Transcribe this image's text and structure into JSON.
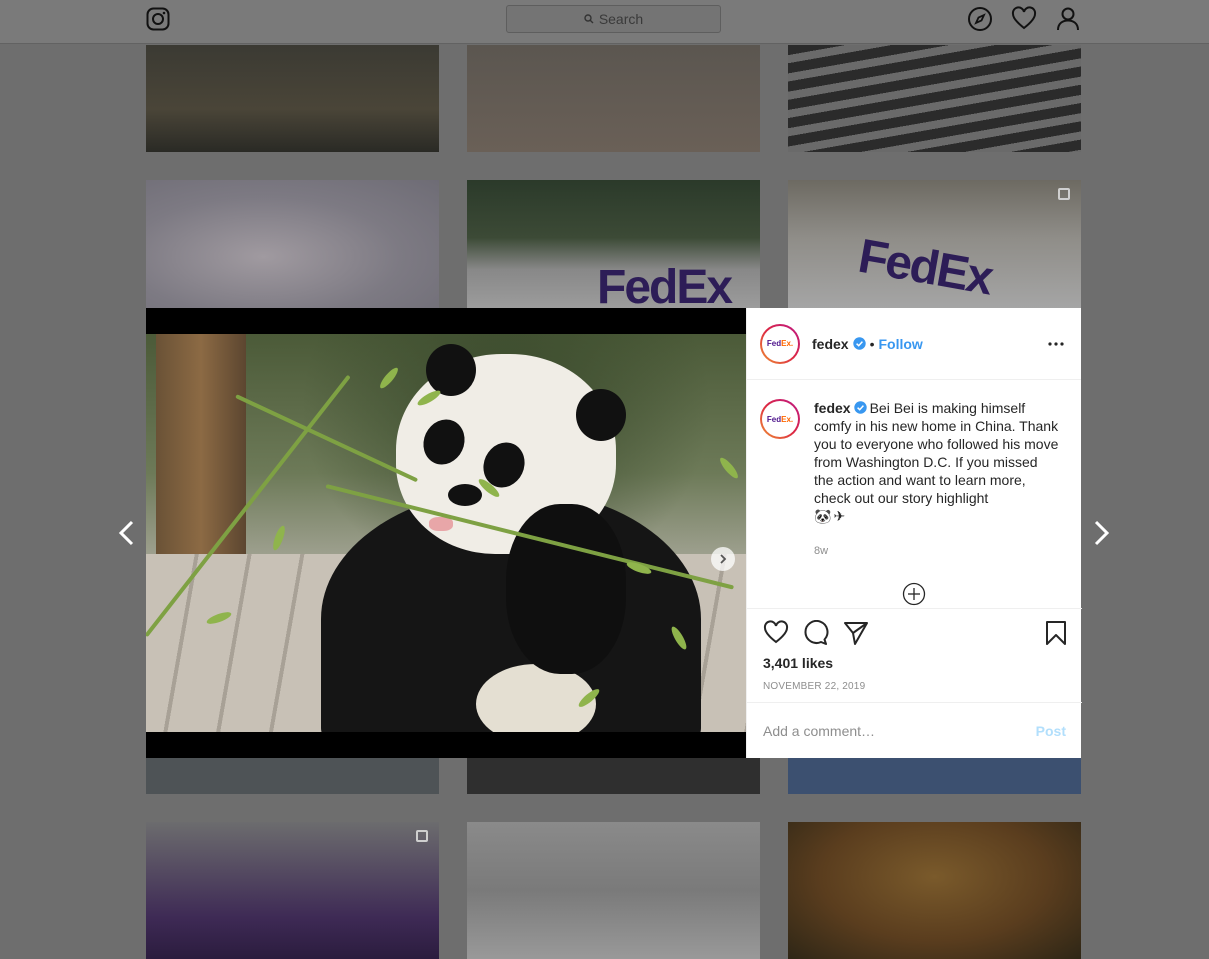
{
  "nav": {
    "search_placeholder": "Search",
    "icons": [
      "instagram-logo",
      "explore-compass-icon",
      "activity-heart-icon",
      "profile-icon"
    ]
  },
  "grid": {
    "tile_texts": [
      "FedEx",
      "FedEx"
    ]
  },
  "media": {
    "subject": "giant panda eating bamboo",
    "carousel_count": 3,
    "carousel_active": 1
  },
  "post": {
    "username": "fedex",
    "avatar_text_fe": "Fed",
    "avatar_text_ex": "Ex.",
    "follow_label": "Follow",
    "separator": "•",
    "caption_user": "fedex",
    "caption": "Bei Bei is making himself comfy in his new home in China. Thank you to everyone who followed his move from Washington D.C. If you missed the action and want to learn more, check out our story highlight",
    "caption_emojis": [
      "🐼",
      "✈"
    ],
    "time_ago": "8w",
    "likes": "3,401 likes",
    "date": "NOVEMBER 22, 2019",
    "comment_placeholder": "Add a comment…",
    "post_label": "Post"
  },
  "colors": {
    "accent": "#3897f0",
    "post_disabled": "#b2dffc",
    "overlay": "#6e6e6e"
  }
}
